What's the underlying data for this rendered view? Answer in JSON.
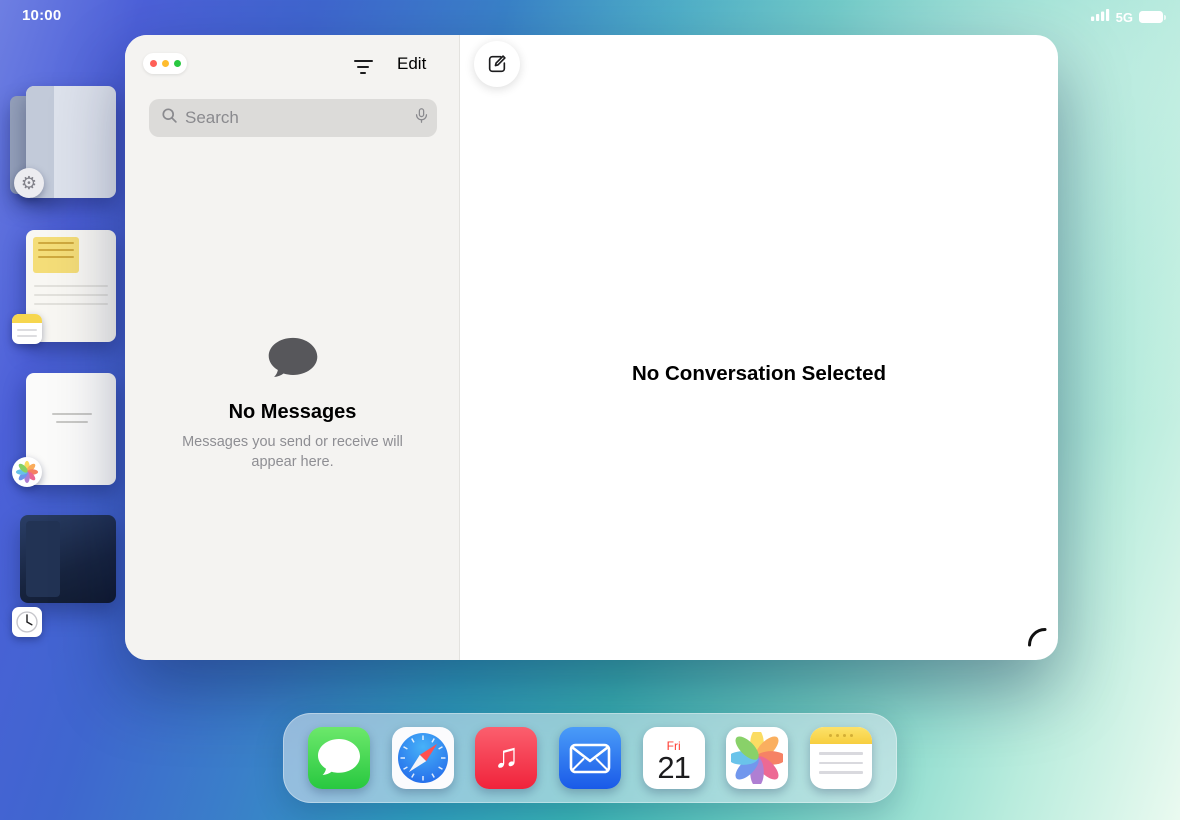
{
  "status_bar": {
    "time": "10:00",
    "network": "5G",
    "battery": "full"
  },
  "stage_manager": {
    "items": [
      {
        "app": "settings"
      },
      {
        "app": "notes"
      },
      {
        "app": "photos"
      },
      {
        "app": "clock"
      }
    ]
  },
  "messages_window": {
    "toolbar": {
      "edit_label": "Edit"
    },
    "search": {
      "placeholder": "Search"
    },
    "sidebar_empty": {
      "title": "No Messages",
      "description": "Messages you send or receive will appear here."
    },
    "main_empty": {
      "title": "No Conversation Selected"
    }
  },
  "dock": {
    "apps": [
      "messages",
      "safari",
      "music",
      "mail",
      "calendar",
      "photos",
      "notes"
    ],
    "calendar": {
      "weekday": "Fri",
      "day": "21"
    }
  },
  "glyphs": {
    "gear": "⚙",
    "music_note": "♫"
  },
  "colors": {
    "traffic_red": "#ff5f57",
    "traffic_yellow": "#febc2e",
    "traffic_green": "#28c840",
    "messages_green": "#28c840",
    "safari_blue": "#1e5fe8",
    "music_red": "#f0233b",
    "mail_blue": "#1a5ae8",
    "calendar_red": "#ff3b30",
    "notes_yellow": "#f7ce3e",
    "sidebar_gray": "#f4f3f1",
    "search_field_gray": "#dcdbd9"
  }
}
